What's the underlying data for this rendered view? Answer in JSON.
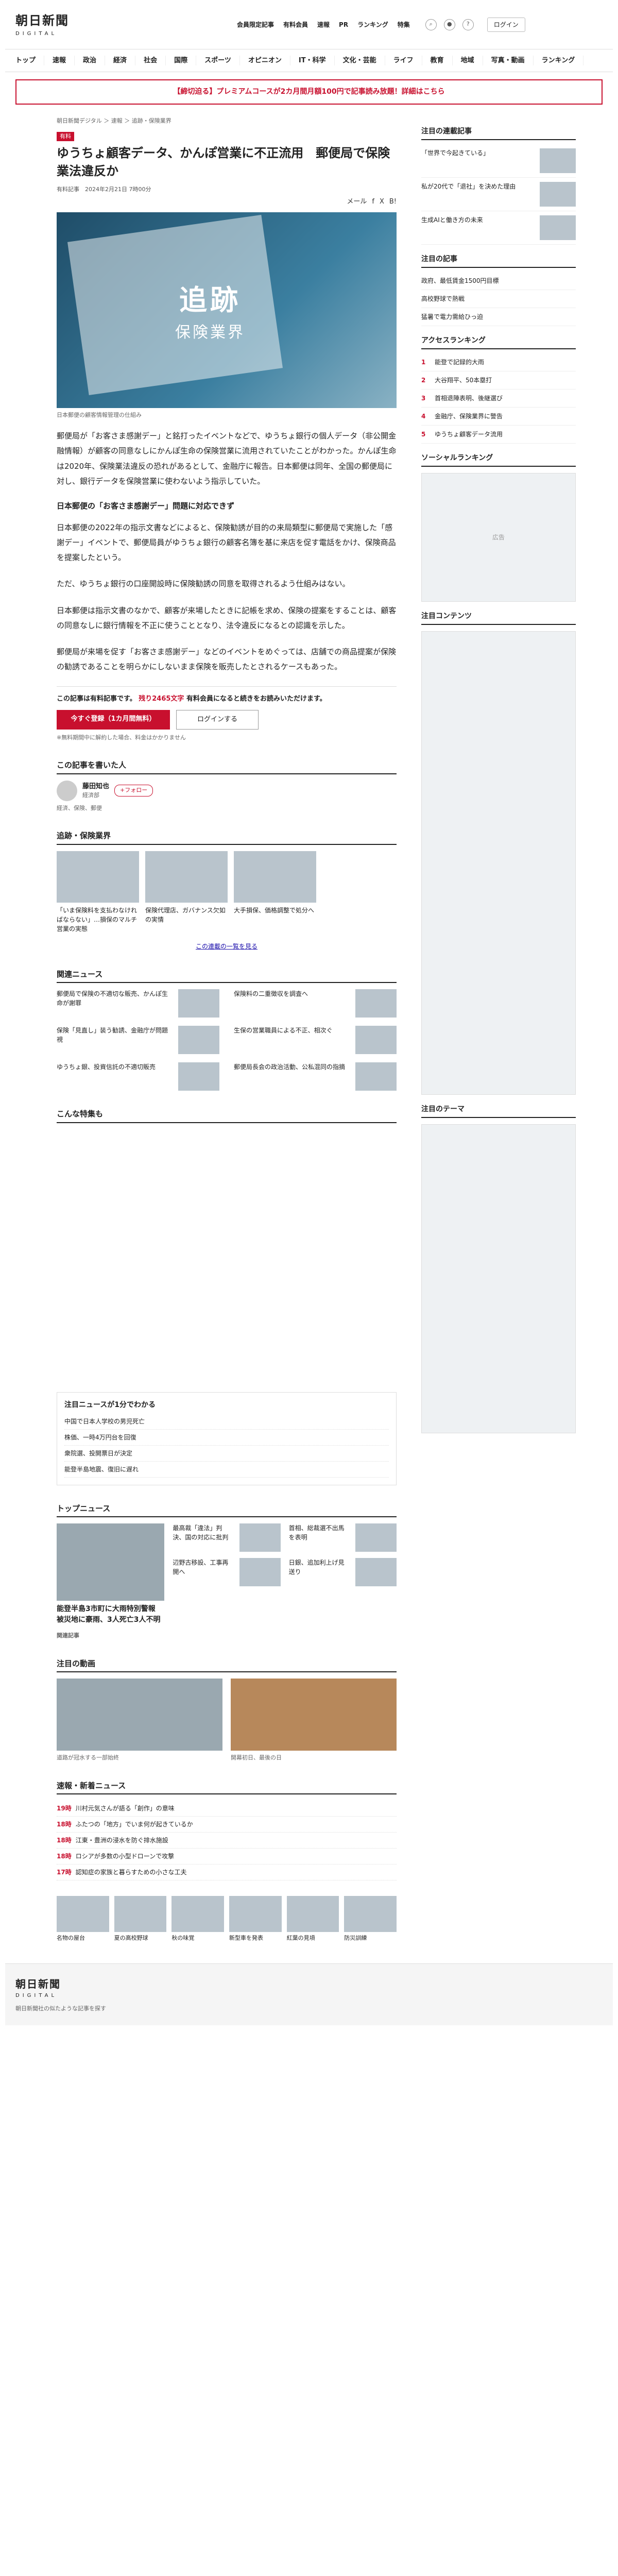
{
  "header": {
    "logo": "朝日新聞",
    "logo_sub": "DIGITAL",
    "toplinks": [
      "会員限定記事",
      "有料会員",
      "速報",
      "PR",
      "ランキング",
      "特集"
    ],
    "login": "ログイン"
  },
  "nav": [
    "トップ",
    "速報",
    "政治",
    "経済",
    "社会",
    "国際",
    "スポーツ",
    "オピニオン",
    "IT・科学",
    "文化・芸能",
    "ライフ",
    "教育",
    "地域",
    "写真・動画",
    "ランキング"
  ],
  "promo": "【締切迫る】プレミアムコースが2カ月間月額100円で記事読み放題！詳細はこちら",
  "article": {
    "breadcrumb": "朝日新聞デジタル ＞ 速報 ＞ 追跡・保険業界",
    "tag": "有料",
    "title": "ゆうちょ顧客データ、かんぽ営業に不正流用　郵便局で保険業法違反か",
    "meta": "有料記事　2024年2月21日 7時00分",
    "shares": [
      "メール",
      "f",
      "X",
      "B!"
    ],
    "hero_a": "追跡",
    "hero_b": "保険業界",
    "caption": "日本郵便の顧客情報管理の仕組み",
    "p1": "郵便局が「お客さま感謝デー」と銘打ったイベントなどで、ゆうちょ銀行の個人データ（非公開金融情報）が顧客の同意なしにかんぽ生命の保険営業に流用されていたことがわかった。かんぽ生命は2020年、保険業法違反の恐れがあるとして、金融庁に報告。日本郵便は同年、全国の郵便局に対し、銀行データを保険営業に使わないよう指示していた。",
    "h_sub": "日本郵便の「お客さま感謝デー」問題に対応できず",
    "p2": "日本郵便の2022年の指示文書などによると、保険勧誘が目的の来局類型に郵便局で実施した「感謝デー」イベントで、郵便局員がゆうちょ銀行の顧客名簿を基に来店を促す電話をかけ、保険商品を提案したという。",
    "p3": "ただ、ゆうちょ銀行の口座開設時に保険勧誘の同意を取得されるよう仕組みはない。",
    "p4": "日本郵便は指示文書のなかで、顧客が来場したときに記帳を求め、保険の提案をすることは、顧客の同意なしに銀行情報を不正に使うこととなり、法令違反になるとの認識を示した。",
    "p5": "郵便局が来場を促す「お客さま感謝デー」などのイベントをめぐっては、店舗での商品提案が保険の勧誘であることを明らかにしないまま保険を販売したとされるケースもあった。",
    "paywall_text": "この記事は有料記事です。",
    "paywall_em": "残り2465文字",
    "paywall_rest": "有料会員になると続きをお読みいただけます。",
    "btn_subscribe": "今すぐ登録（1カ月間無料）",
    "btn_login": "ログインする",
    "paywall_note": "※無料期間中に解約した場合、料金はかかりません"
  },
  "author": {
    "heading": "この記事を書いた人",
    "name": "藤田知也",
    "role": "経済部",
    "desc": "経済、保険、郵便",
    "follow": "+フォロー"
  },
  "series": {
    "heading": "追跡・保険業界",
    "items": [
      "「いま保険料を支払わなければならない」…損保のマルチ営業の実態",
      "保険代理店、ガバナンス欠如の実情",
      "大手損保、価格調整で処分へ"
    ],
    "more": "この連載の一覧を見る"
  },
  "related": {
    "heading": "関連ニュース",
    "items": [
      "郵便局で保険の不適切な販売、かんぽ生命が謝罪",
      "保険料の二重徴収を調査へ",
      "保険「見直し」装う勧誘、金融庁が問題視",
      "生保の営業職員による不正、相次ぐ",
      "ゆうちょ銀、投資信託の不適切販売",
      "郵便局長会の政治活動、公私混同の指摘"
    ],
    "heading2": "こんな特集も"
  },
  "area": {
    "heading": "注目ニュースが1分でわかる",
    "items": [
      "中国で日本人学校の男児死亡",
      "株価、一時4万円台を回復",
      "衆院選、投開票日が決定",
      "能登半島地震、復旧に遅れ"
    ]
  },
  "top_news": {
    "heading": "トップニュース",
    "lead": "能登半島3市町に大雨特別警報　被災地に豪雨、3人死亡3人不明",
    "items": [
      "最高裁「違法」判決、国の対応に批判",
      "辺野古移設、工事再開へ",
      "首相、総裁選不出馬を表明",
      "日銀、追加利上げ見送り"
    ],
    "sub_heading": "関連記事"
  },
  "videos": {
    "heading": "注目の動画",
    "items": [
      "道路が冠水する一部始終",
      "開幕初日、最後の日"
    ]
  },
  "breaking": {
    "heading": "速報・新着ニュース",
    "items": [
      {
        "time": "19時",
        "text": "川村元気さんが語る「創作」の意味"
      },
      {
        "time": "18時",
        "text": "ふたつの「地方」でいま何が起きているか"
      },
      {
        "time": "18時",
        "text": "江東・豊洲の浸水を防ぐ排水施設"
      },
      {
        "time": "18時",
        "text": "ロシアが多数の小型ドローンで攻撃"
      },
      {
        "time": "17時",
        "text": "認知症の家族と暮らすための小さな工夫"
      }
    ]
  },
  "pics": {
    "items": [
      "名物の屋台",
      "夏の高校野球",
      "秋の味覚",
      "新型車を発表",
      "紅葉の見頃",
      "防災訓練"
    ]
  },
  "sidebar": {
    "h1": "注目の連載記事",
    "items1": [
      "「世界で今起きている」",
      "私が20代で「退社」を決めた理由",
      "生成AIと働き方の未来"
    ],
    "h2": "注目の記事",
    "items2": [
      "政府、最低賃金1500円目標",
      "高校野球で熱戦",
      "猛暑で電力需給ひっ迫"
    ],
    "h3": "アクセスランキング",
    "ranking": [
      "能登で記録的大雨",
      "大谷翔平、50本塁打",
      "首相退陣表明、後継選び",
      "金融庁、保険業界に警告",
      "ゆうちょ顧客データ流用"
    ],
    "h4": "ソーシャルランキング",
    "h5": "注目コンテンツ",
    "h6": "注目のテーマ",
    "ad": "広告"
  },
  "footer": {
    "logo": "朝日新聞",
    "logo_sub": "DIGITAL",
    "text": "朝日新聞社の似たような記事を探す"
  }
}
